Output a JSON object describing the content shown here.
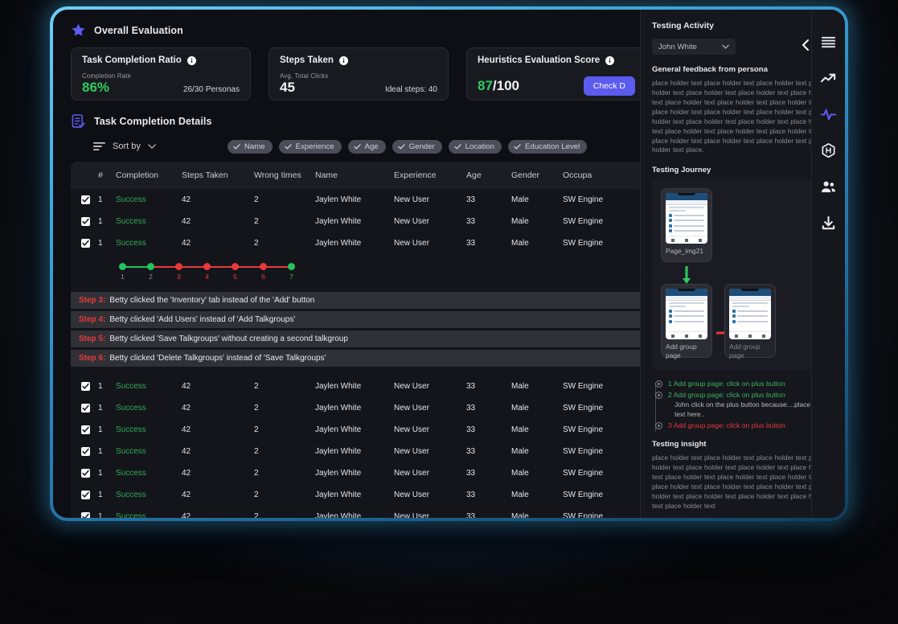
{
  "overall": {
    "section_title": "Overall Evaluation",
    "star_icon": "star-icon",
    "cards": [
      {
        "title": "Task Completion Ratio",
        "info_icon": "info-icon",
        "sub_label": "Completion Rate",
        "value": "86%",
        "note": "26/30 Personas"
      },
      {
        "title": "Steps Taken",
        "info_icon": "info-icon",
        "sub_label": "Avg. Total Clicks",
        "value": "45",
        "note": "Ideal steps: 40"
      },
      {
        "title": "Heuristics Evaluation Score",
        "info_icon": "info-icon",
        "score": "87",
        "score_denominator": "/100",
        "button_label": "Check D"
      }
    ]
  },
  "details": {
    "section_title": "Task Completion Details",
    "doc_icon": "document-check-icon",
    "toolbar": {
      "sort_icon": "sort-lines-icon",
      "sort_label": "Sort by",
      "chevron_icon": "chevron-down-icon",
      "chips": [
        {
          "label": "Name",
          "icon": "check-icon"
        },
        {
          "label": "Experience",
          "icon": "check-icon"
        },
        {
          "label": "Age",
          "icon": "check-icon"
        },
        {
          "label": "Gender",
          "icon": "check-icon"
        },
        {
          "label": "Location",
          "icon": "check-icon"
        },
        {
          "label": "Education Level",
          "icon": "check-icon"
        }
      ]
    },
    "columns": [
      "#",
      "Completion",
      "Steps Taken",
      "Wrong times",
      "Name",
      "Experience",
      "Age",
      "Gender",
      "Occupa"
    ],
    "row_template": {
      "num": "1",
      "completion": "Success",
      "steps_taken": "42",
      "wrong_times": "2",
      "name": "Jaylen White",
      "experience": "New User",
      "age": "33",
      "gender": "Male",
      "occupation": "SW Engine"
    },
    "rows_above": 3,
    "rows_below": 8,
    "timeline": {
      "nodes": [
        {
          "label": "1",
          "state": "ok"
        },
        {
          "label": "2",
          "state": "ok"
        },
        {
          "label": "3",
          "state": "error"
        },
        {
          "label": "4",
          "state": "error"
        },
        {
          "label": "5",
          "state": "error"
        },
        {
          "label": "6",
          "state": "error"
        },
        {
          "label": "7",
          "state": "ok"
        }
      ],
      "colors": {
        "ok": "#21c45a",
        "error": "#e8393b",
        "label_default": "#8a8c95"
      }
    },
    "steps": [
      {
        "label": "Step 3:",
        "text": "Betty clicked the 'Inventory' tab instead of the 'Add' button"
      },
      {
        "label": "Step 4:",
        "text": "Betty clicked 'Add Users' instead of 'Add Talkgroups'"
      },
      {
        "label": "Step 5:",
        "text": "Betty clicked 'Save Talkgroups' without creating a second talkgroup"
      },
      {
        "label": "Step 6:",
        "text": "Betty clicked 'Delete Talkgroups' instead of 'Save Talkgroups'"
      }
    ]
  },
  "panel": {
    "title": "Testing Activity",
    "handle_icon": "chevron-right-icon",
    "persona": {
      "selected": "John White",
      "chevron_icon": "chevron-down-icon",
      "prev_icon": "chevron-left-icon",
      "next_icon": "chevron-right-icon"
    },
    "feedback": {
      "title": "General feedback from persona",
      "body": "place holder text place holder text place holder text place holder text place holder text place holder text place holder text place holder text place holder text place holder text place holder text place holder text place holder text place holder text place holder text place holder text place holder text place holder text place holder text place holder text place holder text  place holder text place holder text place holder text place."
    },
    "journey": {
      "title": "Testing Journey",
      "cards": [
        {
          "label": "Page_img21",
          "state": "current"
        },
        {
          "label": "Add group page",
          "state": "current"
        },
        {
          "label": "Add group page",
          "state": "ghost"
        }
      ],
      "arrow_down_icon": "arrow-down-icon",
      "arrow_right_icon": "arrow-right-icon",
      "steps": [
        {
          "num": "1",
          "text": "Add group page: click on plus button",
          "state": "ok",
          "sub": ""
        },
        {
          "num": "2",
          "text": "Add group page: click on plus button",
          "state": "ok",
          "sub": "John click on the plus button because....place holder text here.."
        },
        {
          "num": "3",
          "text": "Add group page: click on plus button",
          "state": "error",
          "sub": ""
        }
      ]
    },
    "insight": {
      "title": "Testing insight",
      "body": "place holder text place holder text place holder text place holder text place holder text place holder text place holder text place holder text place holder text place holder text place holder text place holder text place holder text place holder text place holder text place holder text place holder text place holder text"
    }
  },
  "rail": {
    "icons": [
      {
        "name": "menu-icon",
        "active": false
      },
      {
        "name": "trending-up-icon",
        "active": false
      },
      {
        "name": "activity-pulse-icon",
        "active": true
      },
      {
        "name": "hexagon-h-icon",
        "active": false
      },
      {
        "name": "users-icon",
        "active": false
      },
      {
        "name": "download-icon",
        "active": false
      }
    ],
    "active_color": "#5b5bf0"
  }
}
